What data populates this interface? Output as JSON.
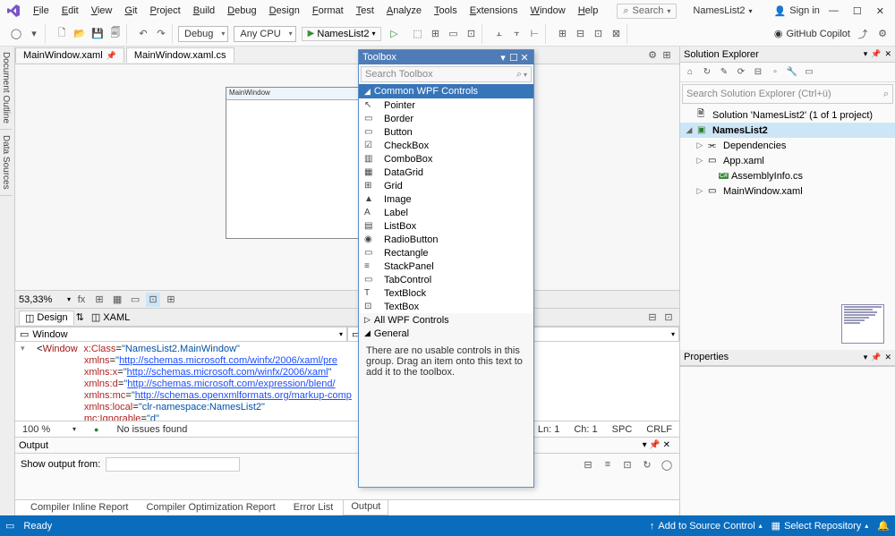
{
  "menubar": {
    "items": [
      "File",
      "Edit",
      "View",
      "Git",
      "Project",
      "Build",
      "Debug",
      "Design",
      "Format",
      "Test",
      "Analyze",
      "Tools",
      "Extensions",
      "Window",
      "Help"
    ],
    "search_placeholder": "Search",
    "project_name": "NamesList2",
    "signin": "Sign in"
  },
  "toolbar": {
    "config": "Debug",
    "platform": "Any CPU",
    "run_target": "NamesList2",
    "copilot": "GitHub Copilot"
  },
  "tabs": {
    "items": [
      {
        "label": "MainWindow.xaml",
        "active": false
      },
      {
        "label": "MainWindow.xaml.cs",
        "active": true
      }
    ]
  },
  "left_strip": {
    "items": [
      "Document Outline",
      "Data Sources"
    ]
  },
  "designer": {
    "window_title": "MainWindow",
    "zoom": "53,33%",
    "dx_tabs": {
      "design": "Design",
      "xaml": "XAML"
    },
    "xaml_bar_label": "Window"
  },
  "code": {
    "line1_pre": "<Window ",
    "line1_attr": "x:Class",
    "line1_val": "NamesList2.MainWindow",
    "line2_attr": "xmlns",
    "line2_val": "http://schemas.microsoft.com/winfx/2006/xaml/pre",
    "line3_attr": "xmlns:x",
    "line3_val": "http://schemas.microsoft.com/winfx/2006/xaml",
    "line4_attr": "xmlns:d",
    "line4_val": "http://schemas.microsoft.com/expression/blend/",
    "line5_attr": "xmlns:mc",
    "line5_val": "http://schemas.openxmlformats.org/markup-comp",
    "line6_attr": "xmlns:local",
    "line6_val": "clr-namespace:NamesList2",
    "line7_attr": "mc:Ignorable",
    "line7_val": "d"
  },
  "code_status": {
    "zoom": "100 %",
    "issues": "No issues found",
    "ln": "Ln: 1",
    "ch": "Ch: 1",
    "spc": "SPC",
    "crlf": "CRLF"
  },
  "output": {
    "title": "Output",
    "show_from_label": "Show output from:"
  },
  "bottom_tabs": [
    "Compiler Inline Report",
    "Compiler Optimization Report",
    "Error List",
    "Output"
  ],
  "bottom_active": 3,
  "solution_explorer": {
    "title": "Solution Explorer",
    "search_placeholder": "Search Solution Explorer (Ctrl+ü)",
    "root": "Solution 'NamesList2' (1 of 1 project)",
    "project": "NamesList2",
    "nodes": [
      "Dependencies",
      "App.xaml",
      "AssemblyInfo.cs",
      "MainWindow.xaml"
    ]
  },
  "properties": {
    "title": "Properties"
  },
  "toolbox": {
    "title": "Toolbox",
    "search_placeholder": "Search Toolbox",
    "cat1": "Common WPF Controls",
    "items": [
      "Pointer",
      "Border",
      "Button",
      "CheckBox",
      "ComboBox",
      "DataGrid",
      "Grid",
      "Image",
      "Label",
      "ListBox",
      "RadioButton",
      "Rectangle",
      "StackPanel",
      "TabControl",
      "TextBlock",
      "TextBox"
    ],
    "icons": [
      "↖",
      "▭",
      "▭",
      "☑",
      "▥",
      "▦",
      "⊞",
      "▲",
      "A",
      "▤",
      "◉",
      "▭",
      "≡",
      "▭",
      "T",
      "⊡"
    ],
    "cat2": "All WPF Controls",
    "cat3": "General",
    "empty_msg": "There are no usable controls in this group. Drag an item onto this text to add it to the toolbox."
  },
  "statusbar": {
    "ready": "Ready",
    "add_source": "Add to Source Control",
    "select_repo": "Select Repository"
  }
}
